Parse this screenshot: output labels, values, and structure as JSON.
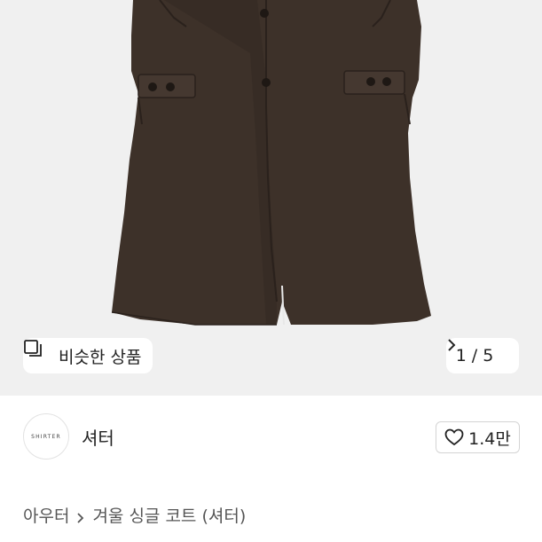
{
  "product_image": {
    "alt_icon": "coat-image",
    "similar_button": {
      "label": "비슷한 상품",
      "icon": "similar-items-icon"
    },
    "pager": {
      "current": "1",
      "separator": "/",
      "total": "5",
      "icon": "chevron-right-icon"
    }
  },
  "shop": {
    "logo_text": "SHIRTER",
    "name": "셔터",
    "like": {
      "icon": "heart-icon",
      "count": "1.4만"
    }
  },
  "breadcrumb": {
    "category": "아우터",
    "product": "겨울 싱글 코트 (셔터)",
    "separator_icon": "chevron-right-icon"
  },
  "colors": {
    "hero_bg": "#f0f0f0",
    "coat": "#3d3129",
    "text": "#222222"
  }
}
